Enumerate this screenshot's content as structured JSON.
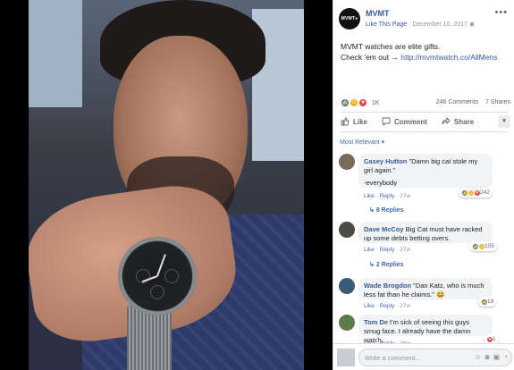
{
  "page": {
    "name": "MVMT",
    "avatar_text": "MVMT●",
    "like_label": "Like This Page",
    "date": "December 10, 2017",
    "more_label": "•••"
  },
  "post": {
    "line1": "MVMT watches are elite gifts.",
    "line2_prefix": "Check 'em out → ",
    "link": "http://mvmtwatch.co/AllMens"
  },
  "reactions": {
    "count": "1K",
    "comments": "246 Comments",
    "shares": "7 Shares"
  },
  "actions": {
    "like": "Like",
    "comment": "Comment",
    "share": "Share"
  },
  "filter": "Most Relevant ▾",
  "comments": [
    {
      "name": "Casey Hutton",
      "text": "\"Damn big cat stole my girl again.\"",
      "text2": "-everybody",
      "like": "Like",
      "reply": "Reply",
      "time": "27w",
      "reaction_count": "242",
      "replies": "8 Replies"
    },
    {
      "name": "Dave McCoy",
      "text": "Big Cat must have racked up some debts betting overs.",
      "like": "Like",
      "reply": "Reply",
      "time": "27w",
      "reaction_count": "105",
      "replies": "2 Replies"
    },
    {
      "name": "Wade Brogdon",
      "text": "\"Dan Katz, who is much less fat than he claims.\" 😂",
      "like": "Like",
      "reply": "Reply",
      "time": "27w",
      "reaction_count": "19"
    },
    {
      "name": "Tom De",
      "text": "I'm sick of seeing this guys smug face. I already have the damn watch.",
      "like": "Like",
      "reply": "Reply",
      "time": "26w",
      "reaction_count": "1"
    }
  ],
  "composer": {
    "placeholder": "Write a comment..."
  }
}
